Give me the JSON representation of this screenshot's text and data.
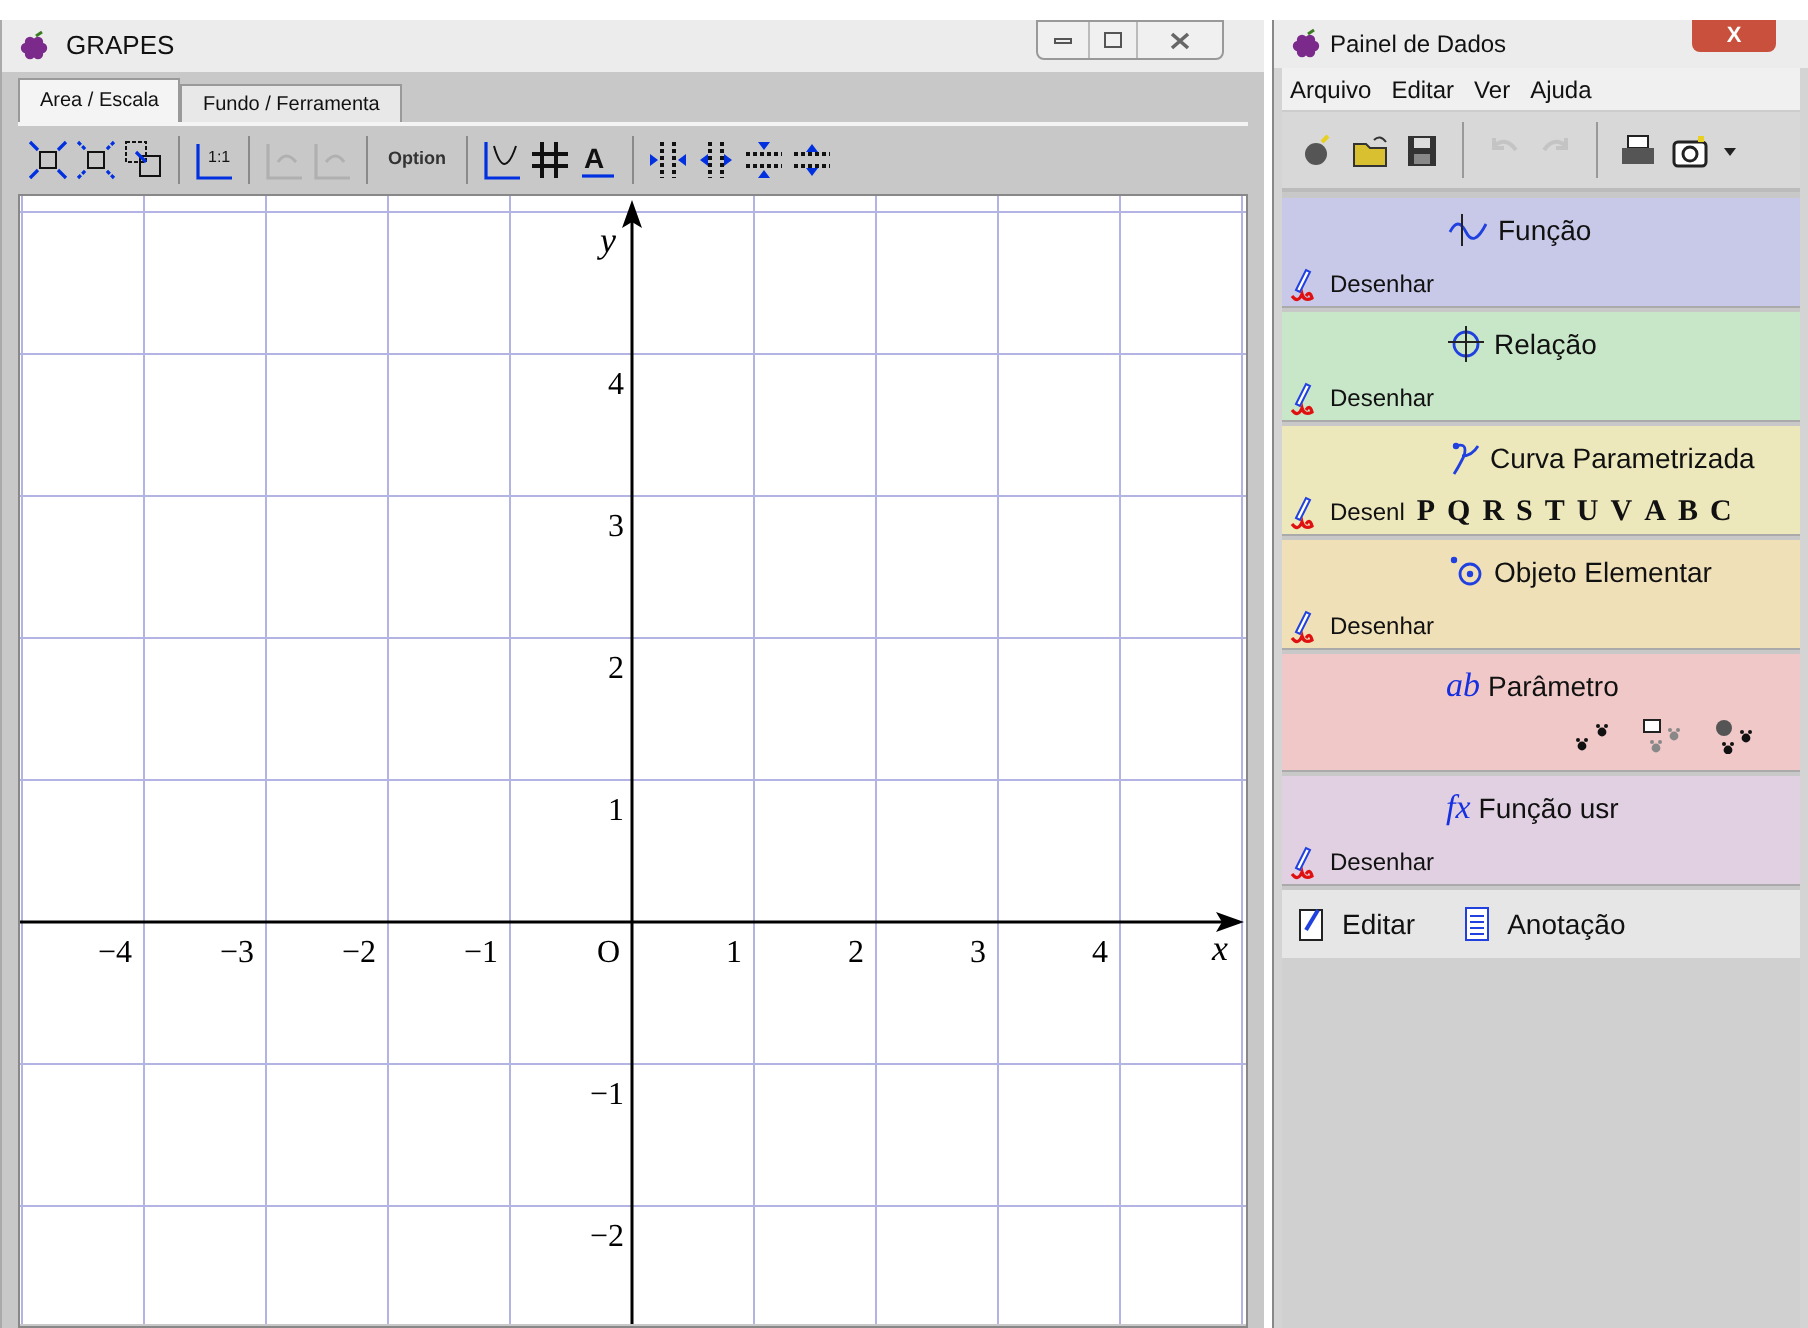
{
  "left_window": {
    "title": "GRAPES",
    "tabs": [
      {
        "label": "Area / Escala",
        "selected": true
      },
      {
        "label": "Fundo / Ferramenta",
        "selected": false
      }
    ],
    "toolbar": [
      {
        "kind": "expand",
        "disabled": false
      },
      {
        "kind": "shrink",
        "disabled": false
      },
      {
        "kind": "zoom-box",
        "disabled": false
      },
      {
        "kind": "sep"
      },
      {
        "kind": "ratio",
        "label": "1:1",
        "disabled": false
      },
      {
        "kind": "sep"
      },
      {
        "kind": "undo-scale",
        "disabled": true
      },
      {
        "kind": "redo-scale",
        "disabled": true
      },
      {
        "kind": "sep"
      },
      {
        "kind": "text",
        "label": "Option",
        "disabled": false
      },
      {
        "kind": "sep"
      },
      {
        "kind": "axes",
        "disabled": false
      },
      {
        "kind": "grid",
        "disabled": false
      },
      {
        "kind": "font",
        "label": "A",
        "disabled": false
      },
      {
        "kind": "sep"
      },
      {
        "kind": "h-in",
        "disabled": false
      },
      {
        "kind": "h-out",
        "disabled": false
      },
      {
        "kind": "v-in",
        "disabled": false
      },
      {
        "kind": "v-out",
        "disabled": false
      }
    ],
    "graph": {
      "x_axis_label": "x",
      "y_axis_label": "y",
      "origin_label": "O",
      "x_ticks": [
        "−4",
        "−3",
        "−2",
        "−1",
        "1",
        "2",
        "3",
        "4"
      ],
      "y_ticks": [
        "4",
        "3",
        "2",
        "1",
        "−1",
        "−2"
      ]
    }
  },
  "right_window": {
    "title": "Painel de Dados",
    "close": "X",
    "menu": [
      "Arquivo",
      "Editar",
      "Ver",
      "Ajuda"
    ],
    "toolbar": [
      {
        "kind": "bomb",
        "disabled": false
      },
      {
        "kind": "open",
        "disabled": false
      },
      {
        "kind": "save",
        "disabled": false
      },
      {
        "kind": "sep"
      },
      {
        "kind": "undo",
        "disabled": true
      },
      {
        "kind": "redo",
        "disabled": true
      },
      {
        "kind": "sep"
      },
      {
        "kind": "print",
        "disabled": false
      },
      {
        "kind": "camera",
        "disabled": false
      },
      {
        "kind": "dropdown",
        "disabled": false
      }
    ],
    "sections": [
      {
        "kind": "function",
        "title": "Função",
        "color": "#c8c8e8",
        "action": "Desenhar"
      },
      {
        "kind": "relation",
        "title": "Relação",
        "color": "#c8e6c8",
        "action": "Desenhar"
      },
      {
        "kind": "curve",
        "title": "Curva Parametrizada",
        "color": "#ece8bc",
        "action": "Desenl",
        "letters": [
          "P",
          "Q",
          "R",
          "S",
          "T",
          "U",
          "V",
          "A",
          "B",
          "C"
        ]
      },
      {
        "kind": "object",
        "title": "Objeto Elementar",
        "color": "#f0e0b8",
        "action": "Desenhar"
      },
      {
        "kind": "parameter",
        "title": "Parâmetro",
        "color": "#f0c8c8",
        "icon_text": "ab"
      },
      {
        "kind": "user-function",
        "title": "Função usr",
        "color": "#e0d0e2",
        "action": "Desenhar",
        "icon_text": "fx"
      }
    ],
    "bottom": [
      {
        "kind": "edit",
        "label": "Editar"
      },
      {
        "kind": "note",
        "label": "Anotação"
      }
    ]
  }
}
